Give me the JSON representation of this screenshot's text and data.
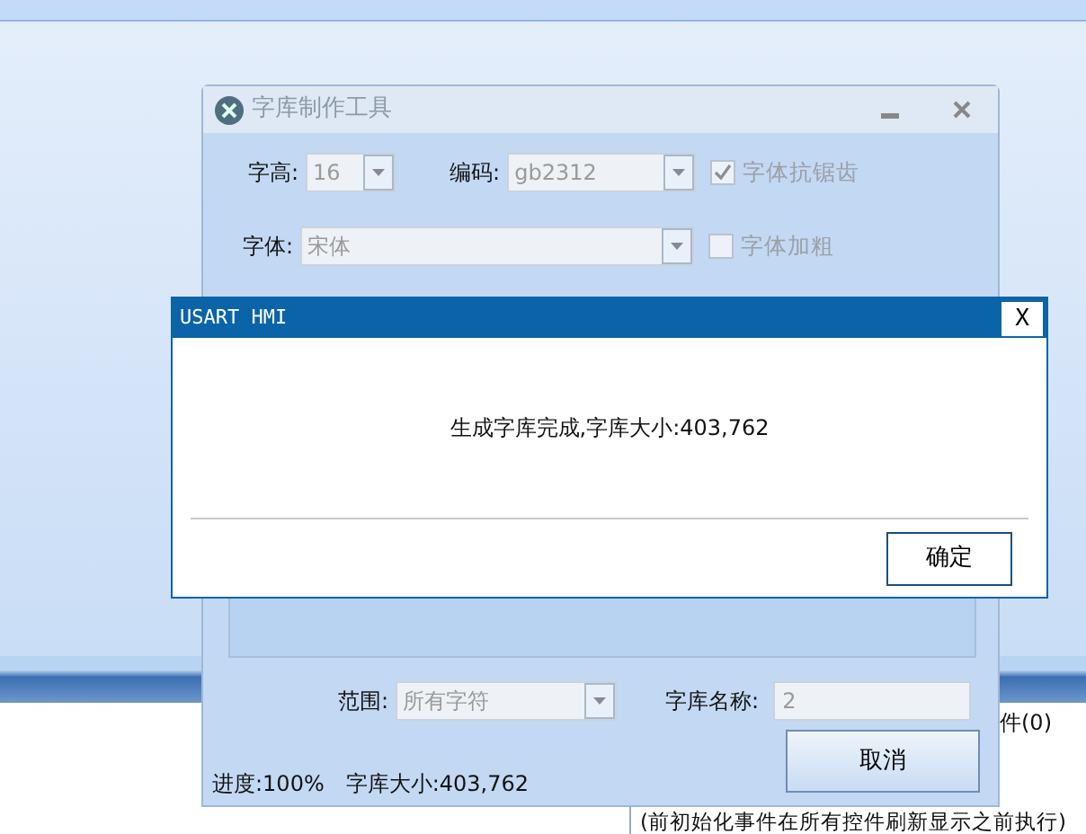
{
  "font_tool": {
    "title": "字库制作工具",
    "height": {
      "label": "字高:",
      "value": "16"
    },
    "encoding": {
      "label": "编码:",
      "value": "gb2312"
    },
    "antialias": {
      "label": "字体抗锯齿",
      "checked": true
    },
    "font": {
      "label": "字体:",
      "value": "宋体"
    },
    "bold": {
      "label": "字体加粗",
      "checked": false
    },
    "range": {
      "label": "范围:",
      "value": "所有字符"
    },
    "library_name": {
      "label": "字库名称:",
      "value": "2"
    },
    "cancel_button": "取消",
    "progress": "进度:100%",
    "size": "字库大小:403,762"
  },
  "dialog": {
    "title": "USART HMI",
    "close": "X",
    "message": "生成字库完成,字库大小:403,762",
    "ok_button": "确定"
  },
  "background": {
    "tab_label": "件(0)",
    "note": "(前初始化事件在所有控件刷新显示之前执行)"
  }
}
